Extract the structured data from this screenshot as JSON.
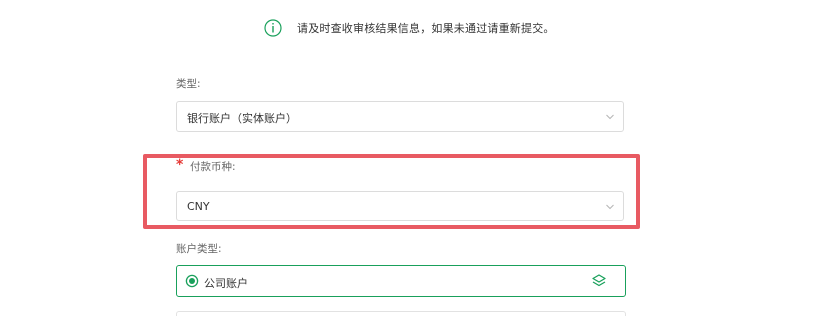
{
  "notice": {
    "icon": "info-icon",
    "text": "请及时查收审核结果信息，如果未通过请重新提交。",
    "icon_color": "#19a05b"
  },
  "fields": {
    "type": {
      "label": "类型:",
      "value": "银行账户（实体账户）"
    },
    "currency": {
      "required_mark": "*",
      "label": "付款币种:",
      "value": "CNY"
    },
    "account_type": {
      "label": "账户类型:",
      "selected_option": "公司账户",
      "option_icon": "layers-icon"
    }
  },
  "colors": {
    "accent": "#19a05b",
    "highlight": "#e85a62",
    "required": "#e53935"
  }
}
